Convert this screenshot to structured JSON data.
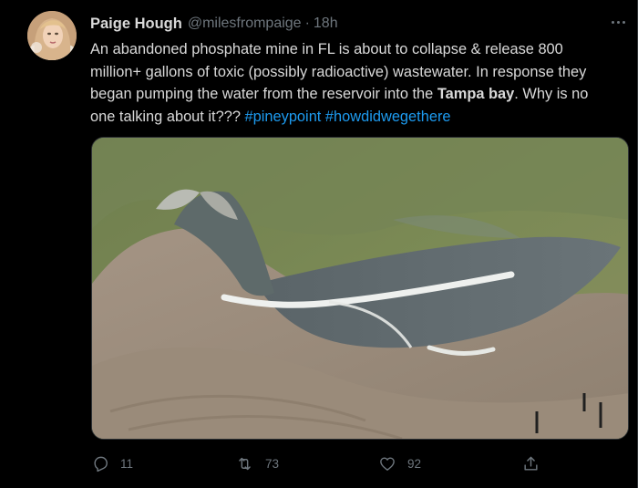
{
  "tweet": {
    "display_name": "Paige Hough",
    "handle": "@milesfrompaige",
    "separator": "·",
    "time": "18h",
    "text": {
      "line1": "An abandoned phosphate mine in FL is about to collapse & release 800",
      "line2": "million+ gallons of toxic (possibly radioactive) wastewater. In response they",
      "line3_before": "began pumping the water from the reservoir into the ",
      "line3_bold": "Tampa bay",
      "line3_after": ". Why is no",
      "line4": "one talking about it???",
      "hashtag1": "#pineypoint",
      "hashtag2": "#howdidwegethere"
    },
    "media": {
      "description_icon": "photo"
    },
    "actions": {
      "reply_count": "11",
      "retweet_count": "73",
      "like_count": "92"
    }
  },
  "colors": {
    "background": "#000000",
    "text": "#d9d9d9",
    "muted": "#6e767d",
    "link": "#1d9bf0"
  },
  "icons": [
    "avatar",
    "more-icon",
    "reply-icon",
    "retweet-icon",
    "like-icon",
    "share-icon"
  ]
}
